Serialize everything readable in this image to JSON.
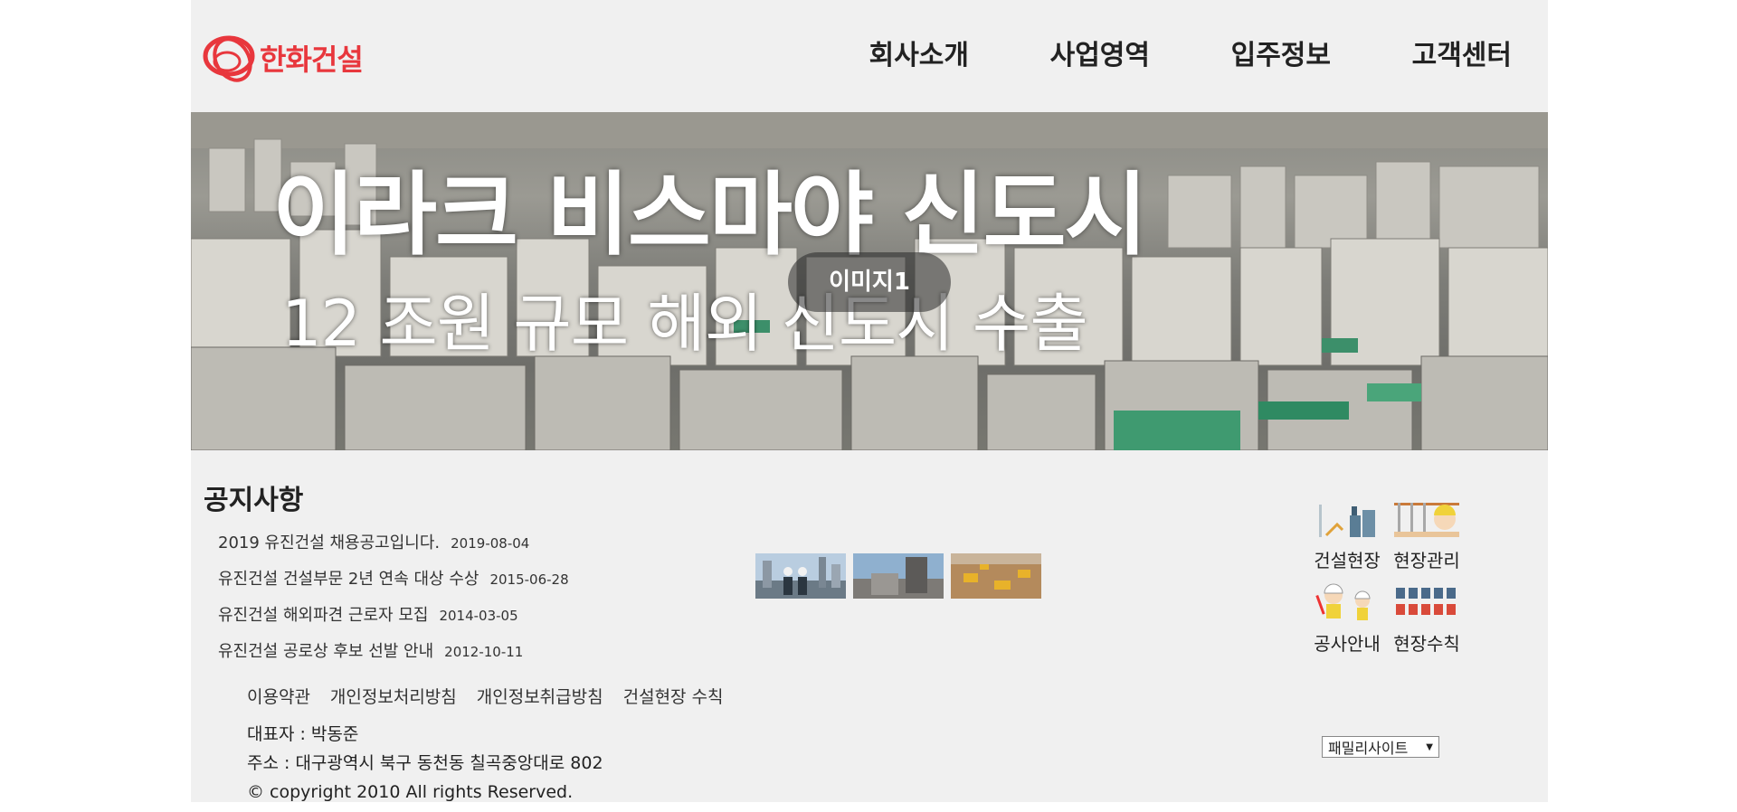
{
  "brand": {
    "logo_text": "한화건설",
    "accent_color": "#e8373d"
  },
  "nav": {
    "items": [
      "회사소개",
      "사업영역",
      "입주정보",
      "고객센터"
    ]
  },
  "banner": {
    "title": "이라크 비스마야 신도시",
    "subtitle": "12 조원 규모 해외 신도시 수출",
    "label": "이미지1"
  },
  "notices": {
    "heading": "공지사항",
    "items": [
      {
        "title": "2019 유진건설 채용공고입니다.",
        "date": "2019-08-04"
      },
      {
        "title": "유진건설 건설부문 2년 연속 대상 수상",
        "date": "2015-06-28"
      },
      {
        "title": "유진건설 해외파견 근로자 모집",
        "date": "2014-03-05"
      },
      {
        "title": "유진건설 공로상 후보 선발 안내",
        "date": "2012-10-11"
      }
    ]
  },
  "quick_links": [
    {
      "label": "건설현장",
      "icon": "construction-site-icon"
    },
    {
      "label": "현장관리",
      "icon": "site-management-icon"
    },
    {
      "label": "공사안내",
      "icon": "construction-guide-icon"
    },
    {
      "label": "현장수칙",
      "icon": "site-rules-icon"
    }
  ],
  "footer": {
    "links": [
      "이용약관",
      "개인정보처리방침",
      "개인정보취급방침",
      "건설현장 수칙"
    ],
    "ceo": "대표자 : 박동준",
    "address": "주소 : 대구광역시 북구 동천동 칠곡중앙대로 802",
    "copyright": "© copyright 2010 All rights Reserved.",
    "family_site": "패밀리사이트"
  }
}
